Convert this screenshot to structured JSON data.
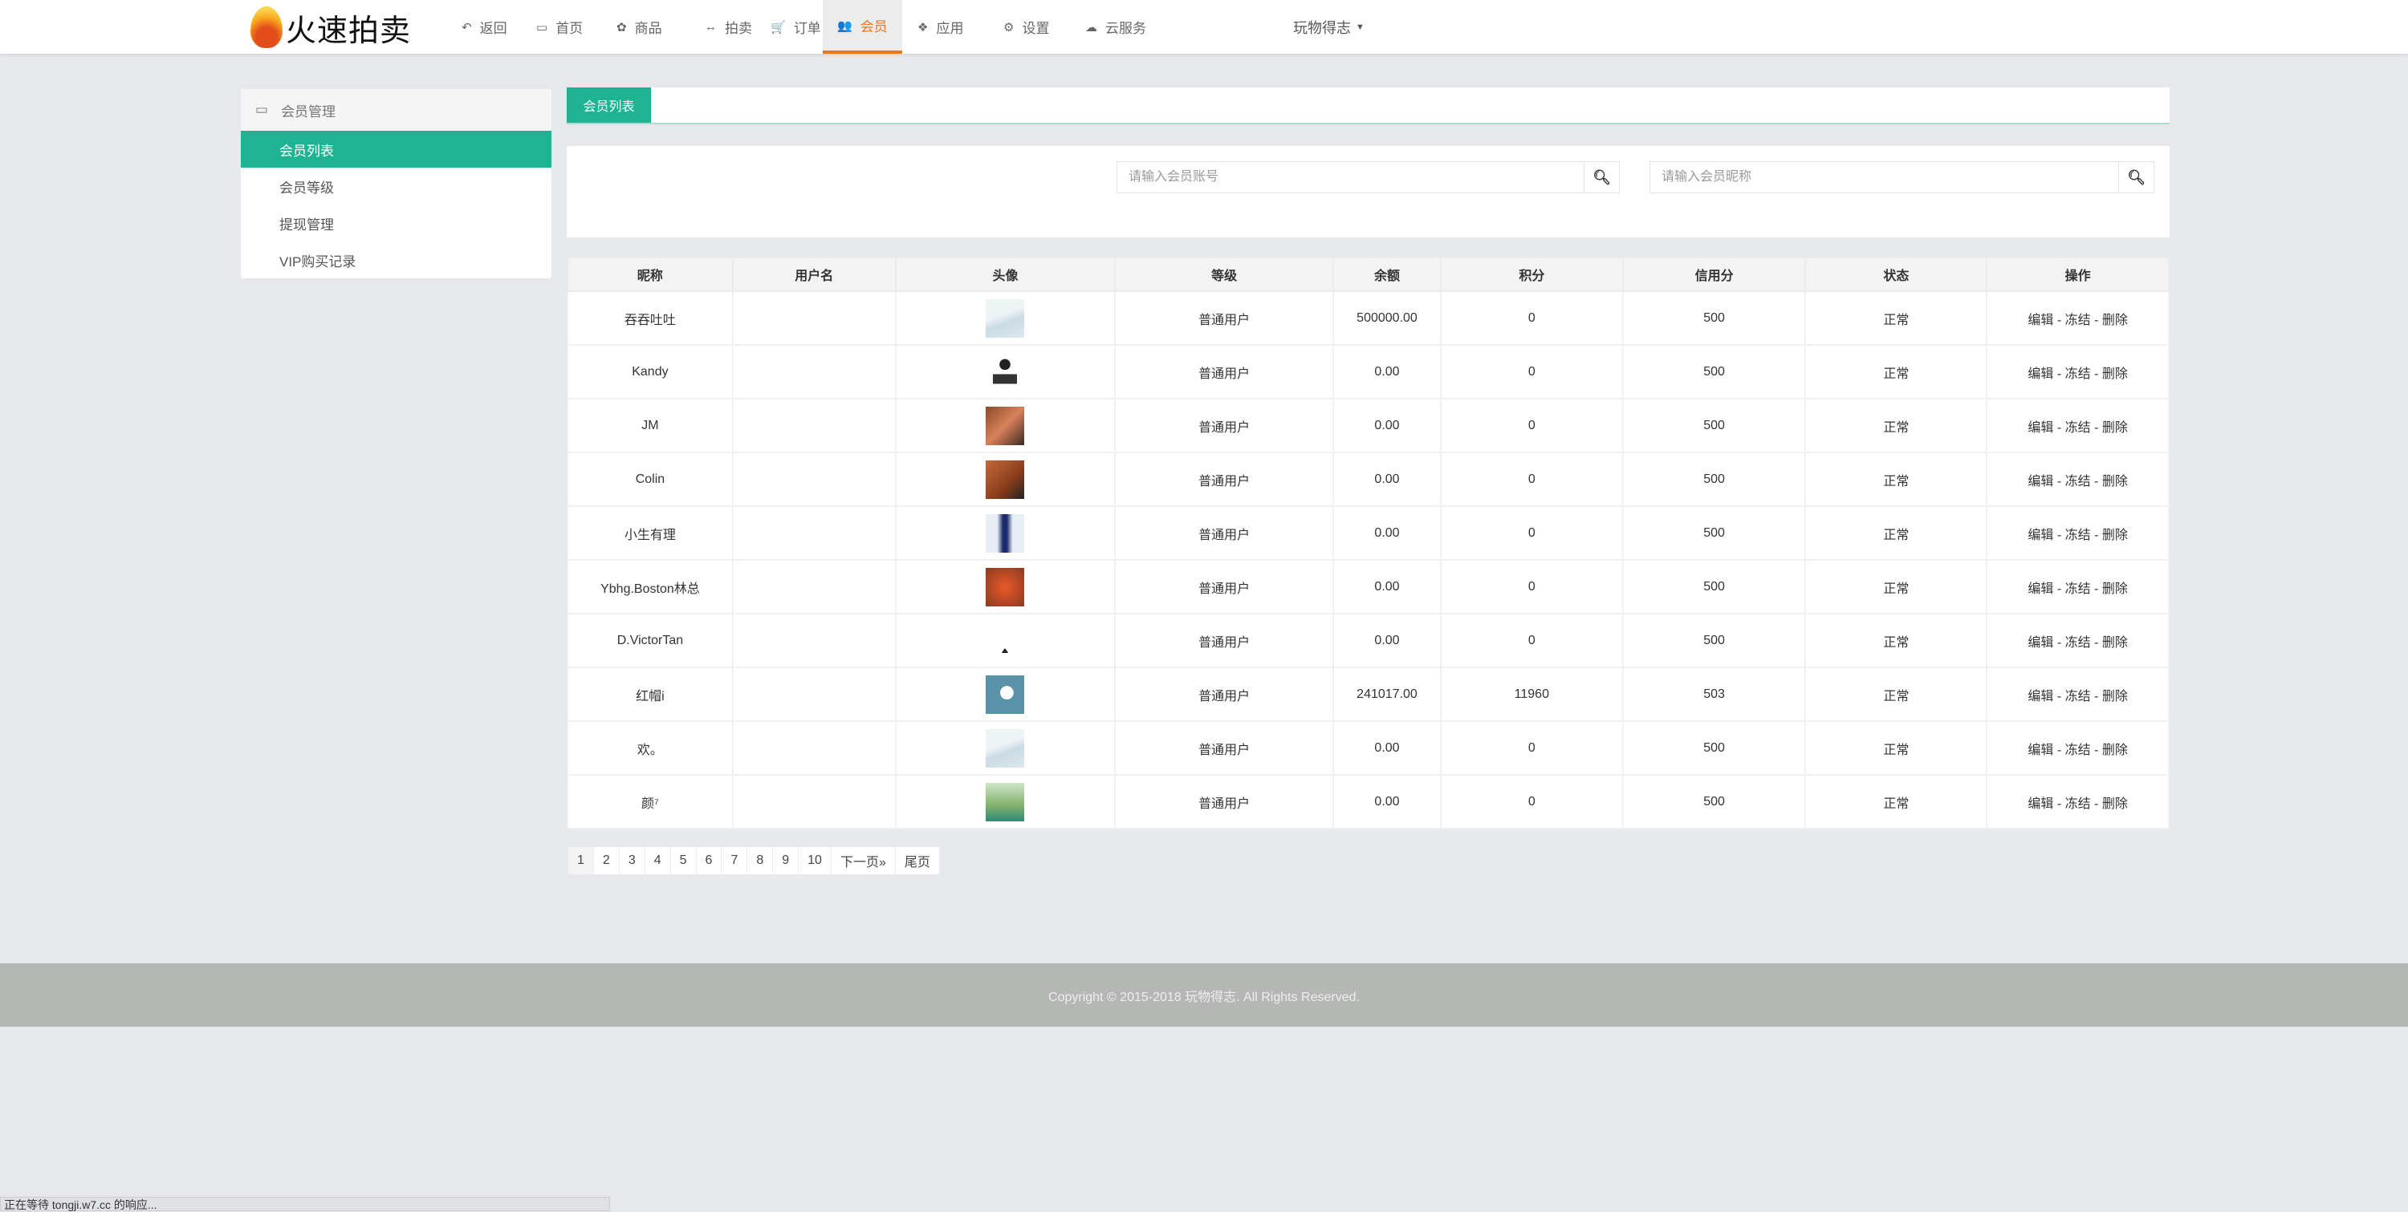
{
  "brand": {
    "name": "火速拍卖"
  },
  "nav": {
    "items": [
      {
        "label": "返回",
        "icon": "back-icon",
        "glyph": "↶"
      },
      {
        "label": "首页",
        "icon": "monitor-icon",
        "glyph": "▭"
      },
      {
        "label": "商品",
        "icon": "gift-icon",
        "glyph": "✿"
      },
      {
        "label": "拍卖",
        "icon": "arrows-icon",
        "glyph": "↔"
      },
      {
        "label": "订单",
        "icon": "cart-icon",
        "glyph": "🛒"
      },
      {
        "label": "会员",
        "icon": "users-icon",
        "glyph": "👥"
      },
      {
        "label": "应用",
        "icon": "apps-icon",
        "glyph": "❖"
      },
      {
        "label": "设置",
        "icon": "gear-icon",
        "glyph": "⚙"
      },
      {
        "label": "云服务",
        "icon": "cloud-icon",
        "glyph": "☁"
      }
    ],
    "active": "会员",
    "user": "玩物得志"
  },
  "sidebar": {
    "title": "会员管理",
    "items": [
      {
        "label": "会员列表"
      },
      {
        "label": "会员等级"
      },
      {
        "label": "提现管理"
      },
      {
        "label": "VIP购买记录"
      }
    ]
  },
  "tab": {
    "label": "会员列表"
  },
  "search": {
    "account_placeholder": "请输入会员账号",
    "nickname_placeholder": "请输入会员昵称"
  },
  "table": {
    "headers": [
      "昵称",
      "用户名",
      "头像",
      "等级",
      "余额",
      "积分",
      "信用分",
      "状态",
      "操作"
    ],
    "rows": [
      {
        "nickname": "吞吞吐吐",
        "username": "",
        "avatar": "placeholder",
        "level": "普通用户",
        "balance": "500000.00",
        "points": "0",
        "credit": "500",
        "status": "正常"
      },
      {
        "nickname": "Kandy",
        "username": "",
        "avatar": "admin",
        "level": "普通用户",
        "balance": "0.00",
        "points": "0",
        "credit": "500",
        "status": "正常"
      },
      {
        "nickname": "JM",
        "username": "",
        "avatar": "photo",
        "level": "普通用户",
        "balance": "0.00",
        "points": "0",
        "credit": "500",
        "status": "正常"
      },
      {
        "nickname": "Colin",
        "username": "",
        "avatar": "photo",
        "level": "普通用户",
        "balance": "0.00",
        "points": "0",
        "credit": "500",
        "status": "正常"
      },
      {
        "nickname": "小生有理",
        "username": "",
        "avatar": "photo",
        "level": "普通用户",
        "balance": "0.00",
        "points": "0",
        "credit": "500",
        "status": "正常"
      },
      {
        "nickname": "Ybhg.Boston林总",
        "username": "",
        "avatar": "photo",
        "level": "普通用户",
        "balance": "0.00",
        "points": "0",
        "credit": "500",
        "status": "正常"
      },
      {
        "nickname": "D.VictorTan",
        "username": "",
        "avatar": "logo",
        "level": "普通用户",
        "balance": "0.00",
        "points": "0",
        "credit": "500",
        "status": "正常"
      },
      {
        "nickname": "红帽i",
        "username": "",
        "avatar": "cat",
        "level": "普通用户",
        "balance": "241017.00",
        "points": "11960",
        "credit": "503",
        "status": "正常"
      },
      {
        "nickname": "欢。",
        "username": "",
        "avatar": "placeholder",
        "level": "普通用户",
        "balance": "0.00",
        "points": "0",
        "credit": "500",
        "status": "正常"
      },
      {
        "nickname": "颜⁷",
        "username": "",
        "avatar": "photo",
        "level": "普通用户",
        "balance": "0.00",
        "points": "0",
        "credit": "500",
        "status": "正常"
      }
    ],
    "actions": {
      "edit": "编辑",
      "freeze": "冻结",
      "delete": "删除",
      "sep": " - "
    }
  },
  "pagination": {
    "pages": [
      "1",
      "2",
      "3",
      "4",
      "5",
      "6",
      "7",
      "8",
      "9",
      "10"
    ],
    "current": "1",
    "next": "下一页»",
    "last": "尾页"
  },
  "footer": {
    "text": "Copyright © 2015-2018 玩物得志. All Rights Reserved."
  },
  "statusbar": {
    "text": "正在等待 tongji.w7.cc 的响应..."
  },
  "colors": {
    "accent": "#1db393",
    "nav_active": "#f0761c"
  }
}
